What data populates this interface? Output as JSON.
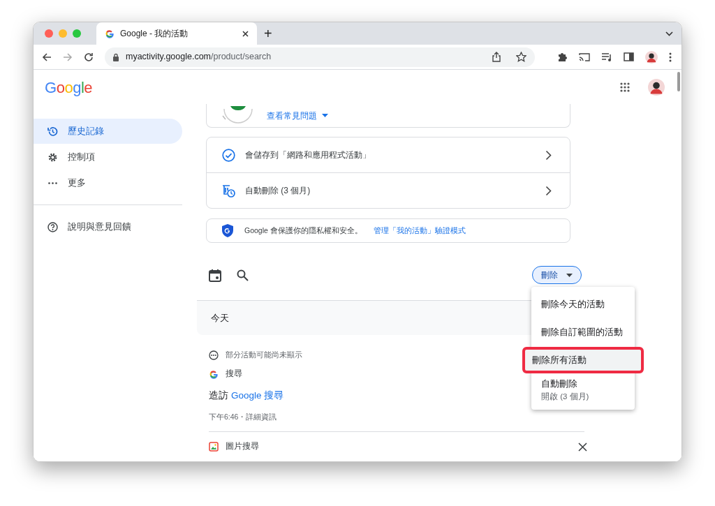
{
  "browser": {
    "tabs": [
      {
        "title": "Google - 我的活動",
        "selected": true
      }
    ],
    "new_tab": "+",
    "address": {
      "host": "myactivity.google.com",
      "path": "/product/search"
    }
  },
  "header": {
    "logo": "Google"
  },
  "sidebar": {
    "items": [
      {
        "label": "歷史記錄",
        "kind": "history",
        "selected": true
      },
      {
        "label": "控制項",
        "kind": "settings",
        "selected": false
      },
      {
        "label": "更多",
        "kind": "more",
        "selected": false
      },
      {
        "label": "說明與意見回饋",
        "kind": "help",
        "selected": false
      }
    ]
  },
  "faq_link": "查看常見問題",
  "settings_rows": [
    {
      "kind": "saving",
      "label": "會儲存到「網路和應用程式活動」"
    },
    {
      "kind": "auto_delete",
      "label": "自動刪除 (3 個月)"
    }
  ],
  "privacy_notice": {
    "text": "Google 會保護你的隱私權和安全。",
    "link": "管理「我的活動」驗證模式"
  },
  "delete_button": {
    "label": "刪除",
    "expanded": true
  },
  "delete_menu": [
    {
      "label": "刪除今天的活動",
      "selected": false
    },
    {
      "label": "刪除自訂範圍的活動",
      "selected": false
    },
    {
      "label": "刪除所有活動",
      "selected": true
    },
    {
      "label": "自動刪除",
      "detail": "開啟 (3 個月)",
      "selected": false
    }
  ],
  "day_heading": "今天",
  "activity": {
    "notice": "部分活動可能尚未顯示",
    "product": "搜尋",
    "title_prefix": "造訪",
    "title_link": "Google 搜尋",
    "meta": "下午6:46・詳細資訊"
  },
  "next_item": {
    "product": "圖片搜尋"
  }
}
